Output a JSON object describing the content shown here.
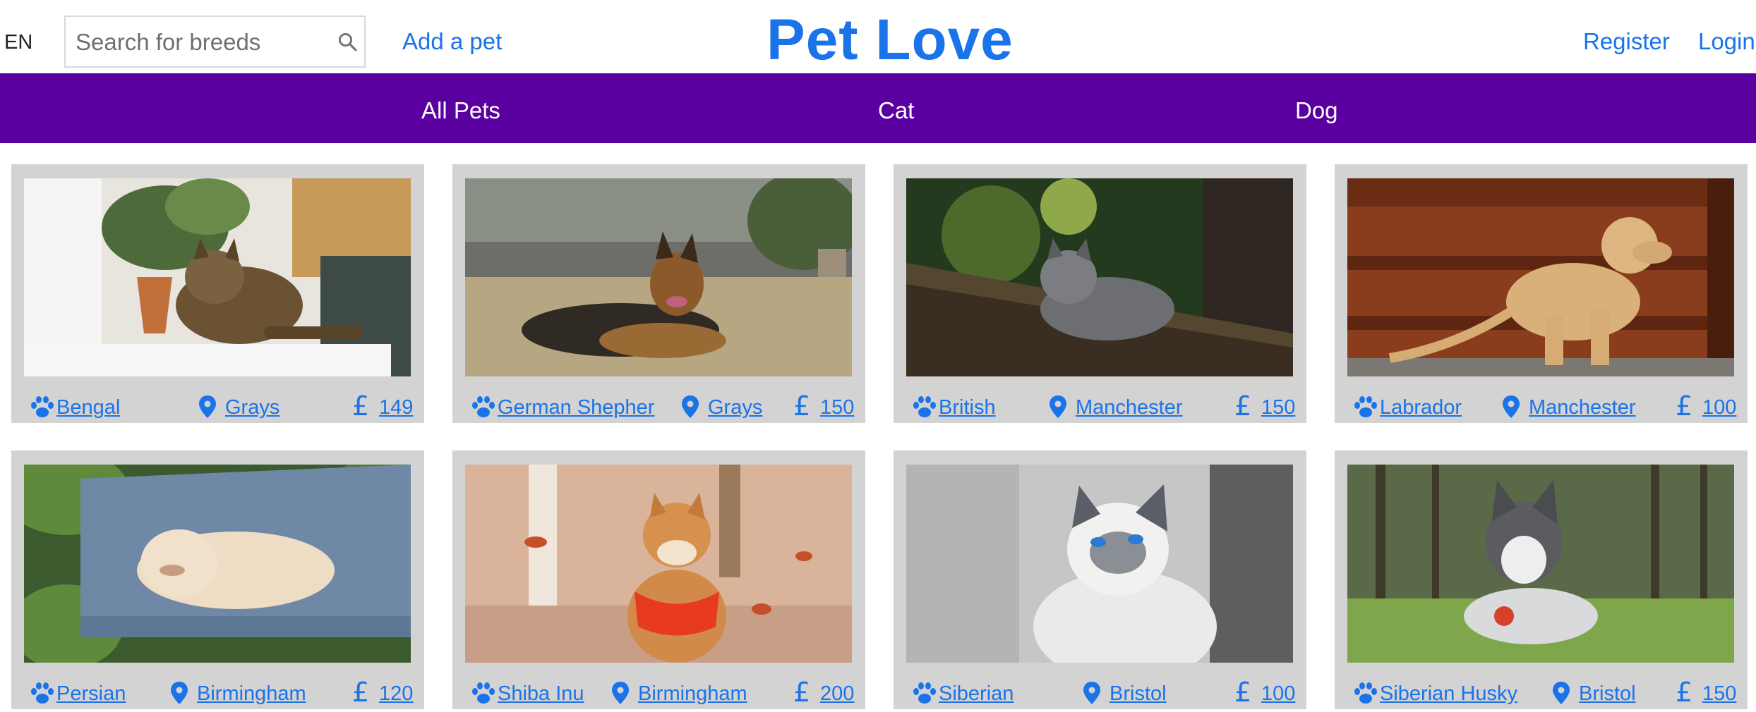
{
  "header": {
    "language": "EN",
    "search_placeholder": "Search for breeds",
    "add_pet": "Add a pet",
    "brand": "Pet Love",
    "register": "Register",
    "login": "Login"
  },
  "nav": {
    "tabs": [
      "All Pets",
      "Cat",
      "Dog"
    ]
  },
  "colors": {
    "accent": "#1a73e8",
    "nav_bg": "#5a00a0",
    "card_bg": "#d3d3d3"
  },
  "pets": [
    {
      "breed": "Bengal",
      "city": "Grays",
      "price": "149"
    },
    {
      "breed": "German Shepher",
      "city": "Grays",
      "price": "150"
    },
    {
      "breed": "British",
      "city": "Manchester",
      "price": "150"
    },
    {
      "breed": "Labrador",
      "city": "Manchester",
      "price": "100"
    },
    {
      "breed": "Persian",
      "city": "Birmingham",
      "price": "120"
    },
    {
      "breed": "Shiba Inu",
      "city": "Birmingham",
      "price": "200"
    },
    {
      "breed": "Siberian",
      "city": "Bristol",
      "price": "100"
    },
    {
      "breed": "Siberian Husky",
      "city": "Bristol",
      "price": "150"
    }
  ]
}
